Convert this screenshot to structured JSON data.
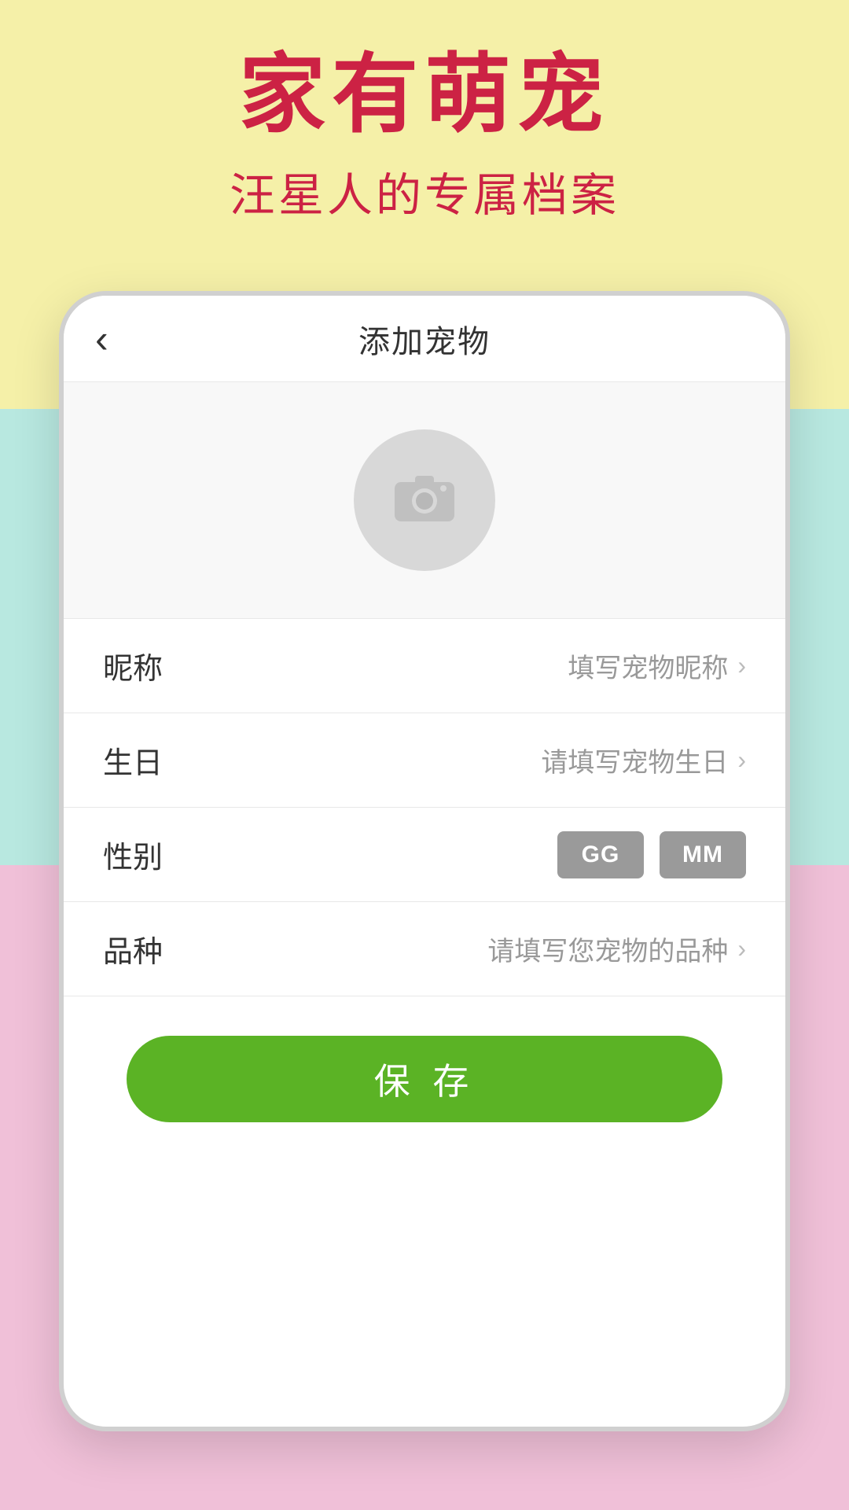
{
  "hero": {
    "title": "家有萌宠",
    "subtitle": "汪星人的专属档案"
  },
  "nav": {
    "back_icon": "‹",
    "title": "添加宠物"
  },
  "photo": {
    "placeholder_icon": "📷"
  },
  "form": {
    "fields": [
      {
        "label": "昵称",
        "placeholder": "填写宠物昵称",
        "type": "text"
      },
      {
        "label": "生日",
        "placeholder": "请填写宠物生日",
        "type": "date"
      },
      {
        "label": "性别",
        "placeholder": "",
        "type": "gender"
      },
      {
        "label": "品种",
        "placeholder": "请填写您宠物的品种",
        "type": "text"
      }
    ],
    "gender_options": [
      "GG",
      "MM"
    ]
  },
  "buttons": {
    "save_label": "保 存",
    "back_label": "‹"
  },
  "colors": {
    "bg_top": "#f5f0a8",
    "bg_middle": "#b8e8e0",
    "bg_bottom": "#f0c0d8",
    "hero_text": "#cc2244",
    "save_btn": "#5bb325",
    "gender_btn": "#9a9a9a"
  }
}
